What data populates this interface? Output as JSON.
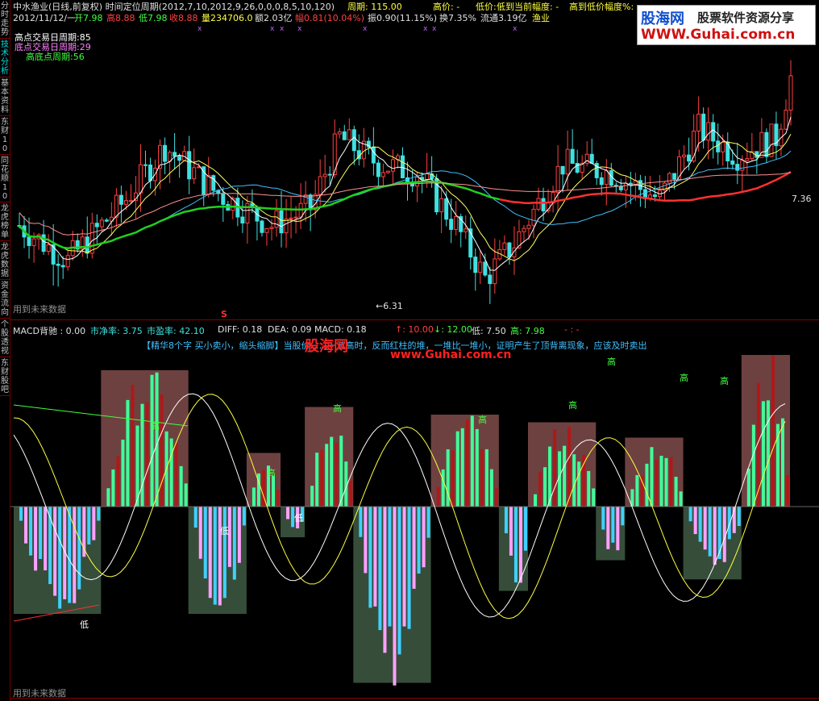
{
  "sidebar": [
    {
      "label": "分时走势",
      "active": false
    },
    {
      "label": "技术分析",
      "active": true
    },
    {
      "label": "基本资料",
      "active": false
    },
    {
      "label": "东财10",
      "active": false
    },
    {
      "label": "同花顺10",
      "active": false
    },
    {
      "label": "龙虎榜单",
      "active": false
    },
    {
      "label": "龙虎数据",
      "active": false
    },
    {
      "label": "资金流向",
      "active": false
    },
    {
      "label": "个股透视",
      "active": false
    },
    {
      "label": "东财股吧",
      "active": false
    }
  ],
  "header": {
    "title": "中水渔业(日线,前复权) 时间定位周期(2012,7,10,2012,9,26,0,0,0,8,5,10,120)",
    "period_label": "周期: 115.00",
    "high_price": "高价: -",
    "low_price": "低价: -",
    "high_to_now": "低到当前幅度: -",
    "high_to_low": "高到低价幅度%: -",
    "date": "2012/11/12/一",
    "open": "开7.98",
    "high": "高8.88",
    "low": "低7.98",
    "close": "收8.88",
    "volume": "量234706.0",
    "amount": "额2.03亿",
    "change": "幅0.81(10.04%)",
    "amplitude": "振0.90(11.15%)",
    "turnover": "换7.35%",
    "float": "流通3.19亿",
    "sector": "渔业"
  },
  "legend": {
    "l1": "高点交易日周期:85",
    "l2": "底点交易日周期:29",
    "l3": "高底点周期:56"
  },
  "price_labels": {
    "last": "7.36",
    "low": "6.31",
    "s_mark": "S"
  },
  "no_future": "用到未来数据",
  "macd_header": {
    "back": "MACD背驰 : 0.00",
    "jingzhi": "市净率: 3.75",
    "shiying": "市盈率: 42.10",
    "diff": "DIFF: 0.18",
    "dea": "DEA: 0.09",
    "macd": "MACD: 0.18",
    "up": "↑: 10.00",
    "down": "↓: 12.00",
    "lo": "低: 7.50",
    "hi": "高: 7.98",
    "tail": "- : -"
  },
  "notice": "【精华8个字 买小卖小，缩头缩脚】当股价……一波高时，反而红柱的堆，一堆比一堆小，证明产生了顶背离现象，应该及时卖出",
  "watermark": {
    "brand": "股海网",
    "slogan": "股票软件资源分享",
    "url": "WWW.Guhai.com.cn",
    "overlay1": "股海网",
    "overlay2": "www.Guhai.com.cn"
  },
  "macd_marks": {
    "high": "高",
    "low": "低"
  },
  "colors": {
    "up": "#ff4040",
    "down": "#40e0e0",
    "ma_green": "#20d020",
    "ma_red": "#ff3030",
    "bar_pos": "#40ff9a",
    "bar_neg": "#ffa0ff"
  }
}
